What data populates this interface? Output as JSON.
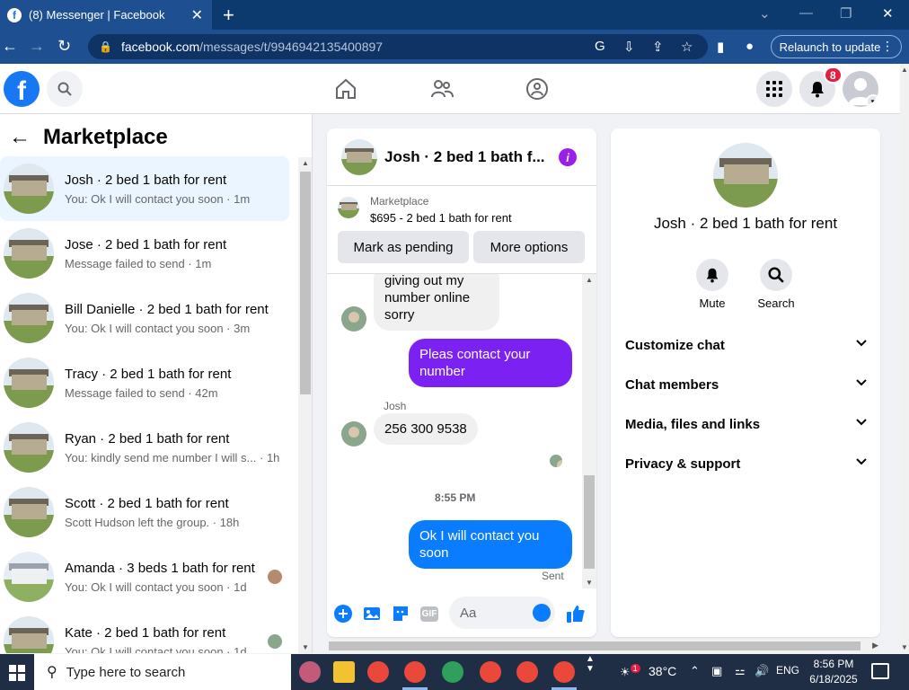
{
  "browser": {
    "tab_title": "(8) Messenger | Facebook",
    "url_host": "facebook.com",
    "url_path": "/messages/t/9946942135400897",
    "relaunch_label": "Relaunch to update"
  },
  "fb": {
    "notification_count": "8"
  },
  "sidebar": {
    "title": "Marketplace",
    "conversations": [
      {
        "name": "Josh · 2 bed 1 bath for rent",
        "preview": "You: Ok I will contact you soon · 1m",
        "active": true
      },
      {
        "name": "Jose · 2 bed 1 bath for rent",
        "preview": "Message failed to send · 1m"
      },
      {
        "name": "Bill Danielle · 2 bed 1 bath for rent",
        "preview": "You: Ok I will contact you soon · 3m"
      },
      {
        "name": "Tracy · 2 bed 1 bath for rent",
        "preview": "Message failed to send · 42m"
      },
      {
        "name": "Ryan · 2 bed 1 bath for rent",
        "preview": "You: kindly send me number I will s... · 1h"
      },
      {
        "name": "Scott · 2 bed 1 bath for rent",
        "preview": "Scott Hudson left the group. · 18h"
      },
      {
        "name": "Amanda · 3 beds 1 bath for rent",
        "preview": "You: Ok I will contact you soon · 1d"
      },
      {
        "name": "Kate · 2 bed 1 bath for rent",
        "preview": "You: Ok I will contact you soon · 1d"
      }
    ]
  },
  "chat": {
    "title": "Josh · 2 bed 1 bath f...",
    "listing_category": "Marketplace",
    "listing_price": "$695 - 2 bed 1 bath for rent",
    "mark_pending_label": "Mark as pending",
    "more_options_label": "More options",
    "msg_in_1": "giving out my number online sorry",
    "msg_out_1": "Pleas contact your number",
    "sender_name": "Josh",
    "msg_in_2": "256 300 9538",
    "timestamp": "8:55 PM",
    "msg_out_2": "Ok I will contact you soon",
    "sent_label": "Sent",
    "composer_placeholder": "Aa",
    "gif_label": "GIF"
  },
  "info": {
    "name": "Josh · 2 bed 1 bath for rent",
    "mute_label": "Mute",
    "search_label": "Search",
    "sections": [
      "Customize chat",
      "Chat members",
      "Media, files and links",
      "Privacy & support"
    ]
  },
  "taskbar": {
    "search_placeholder": "Type here to search",
    "weather": "38°C",
    "weather_badge": "1",
    "lang": "ENG",
    "time": "8:56 PM",
    "date": "6/18/2025"
  },
  "colors": {
    "fb_blue": "#1877f2",
    "messenger_blue": "#0a7cff",
    "purple_bubble": "#7b22f2",
    "badge_red": "#e41e3f"
  }
}
